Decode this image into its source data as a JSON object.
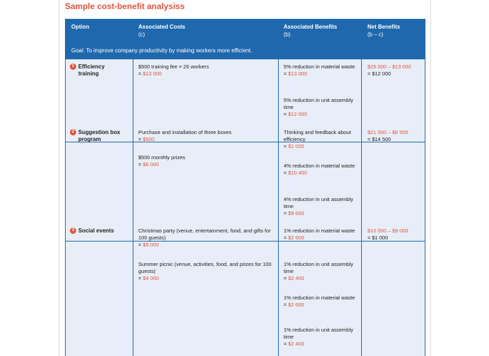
{
  "title": "Sample cost-benefit analysiss",
  "header": {
    "option": "Option",
    "costs": "Associated Costs",
    "costs_sub": "(c)",
    "benefits": "Associated Benefits",
    "benefits_sub": "(b)",
    "net": "Net Benefits",
    "net_sub": "(b – c)"
  },
  "goal": "Goal: To improve company productivity by making workers more efficient.",
  "rows": [
    {
      "num": "1",
      "option": "Efficiency training",
      "costs": [
        {
          "desc": "$500 training fee × 26 workers",
          "prefix": "= ",
          "value": "$13 000"
        }
      ],
      "benefits": [
        {
          "desc": "5% reduction in material waste",
          "prefix": "= ",
          "value": "$13 000"
        },
        {
          "desc": "5% reduction in unit assembly time",
          "prefix": "= ",
          "value": "$12 000"
        }
      ],
      "net_calc": "$25 000 – $13 000",
      "net_result": "= $12 000"
    },
    {
      "num": "2",
      "option": "Suggestion box program",
      "costs": [
        {
          "desc": "Purchase and installation of three boxes",
          "prefix": "= ",
          "value": "$500"
        },
        {
          "desc": "$500 monthly prizes",
          "prefix": "= ",
          "value": "$6 000"
        }
      ],
      "benefits": [
        {
          "desc": "Thinking and feedback about efficiency",
          "prefix": "= ",
          "value": "$1 000"
        },
        {
          "desc": "4% reduction in material waste",
          "prefix": "= ",
          "value": "$10 400"
        },
        {
          "desc": "4% reduction in unit assembly time",
          "prefix": "= ",
          "value": "$9 600"
        }
      ],
      "net_calc": "$21 000 – $6 500",
      "net_result": "= $14 500"
    },
    {
      "num": "3",
      "option": "Social events",
      "costs": [
        {
          "desc": "Christmas party (venue, entertainment, food, and gifts for 100 guests)",
          "prefix": "= ",
          "value": "$5 000"
        },
        {
          "desc": "Summer picnic (venue, activities, food, and prizes for 100 guests)",
          "prefix": "= ",
          "value": "$4 000"
        }
      ],
      "benefits": [
        {
          "desc": "1% reduction in material waste",
          "prefix": "= ",
          "value": "$2 600"
        },
        {
          "desc": "1% reduction in unit assembly time",
          "prefix": "= ",
          "value": "$2 400"
        },
        {
          "desc": "1% reduction in material waste",
          "prefix": "= ",
          "value": "$2 600"
        },
        {
          "desc": "1% reduction in unit assembly time",
          "prefix": "= ",
          "value": "$2 400"
        }
      ],
      "net_calc": "$10 000 – $9 000",
      "net_result": "= $1 000"
    }
  ],
  "colors": {
    "accent": "#e2543e",
    "header_blue": "#1f68ae",
    "cell_bg": "#e7eef7"
  }
}
